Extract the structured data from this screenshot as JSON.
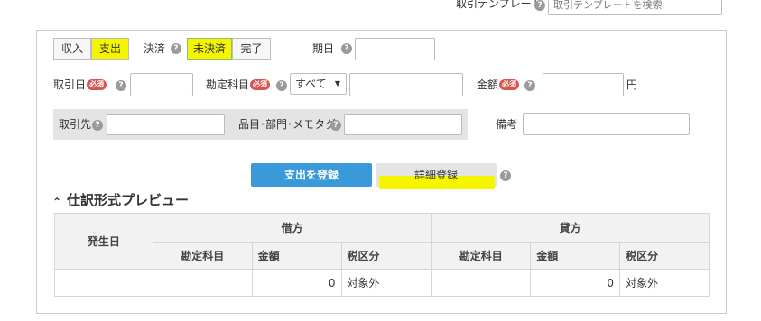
{
  "template": {
    "label": "取引テンプレート",
    "search_placeholder": "取引テンプレートを検索"
  },
  "type_toggle": {
    "income": "収入",
    "expense": "支出"
  },
  "settlement": {
    "label": "決済",
    "unsettled": "未決済",
    "completed": "完了"
  },
  "due_date": {
    "label": "期日"
  },
  "transaction_date": {
    "label": "取引日",
    "required": "必須"
  },
  "account": {
    "label": "勘定科目",
    "required": "必須",
    "select_value": "すべて"
  },
  "amount": {
    "label": "金額",
    "required": "必須",
    "unit": "円"
  },
  "partner": {
    "label": "取引先"
  },
  "item_tags": {
    "label": "品目･部門･メモタグ"
  },
  "remarks": {
    "label": "備考"
  },
  "buttons": {
    "register_expense": "支出を登録",
    "detail_register": "詳細登録"
  },
  "preview": {
    "title": "仕訳形式プレビュー",
    "headers": {
      "date": "発生日",
      "debit": "借方",
      "credit": "貸方",
      "debit_account": "勘定科目",
      "debit_amount": "金額",
      "debit_tax": "税区分",
      "credit_account": "勘定科目",
      "credit_amount": "金額",
      "credit_tax": "税区分"
    },
    "row": {
      "date": "",
      "debit_account": "",
      "debit_amount": "0",
      "debit_tax": "対象外",
      "credit_account": "",
      "credit_amount": "0",
      "credit_tax": "対象外"
    }
  },
  "colors": {
    "primary_button": "#3a9ad9",
    "highlight": "#f5f500",
    "required_badge": "#d9534f"
  }
}
